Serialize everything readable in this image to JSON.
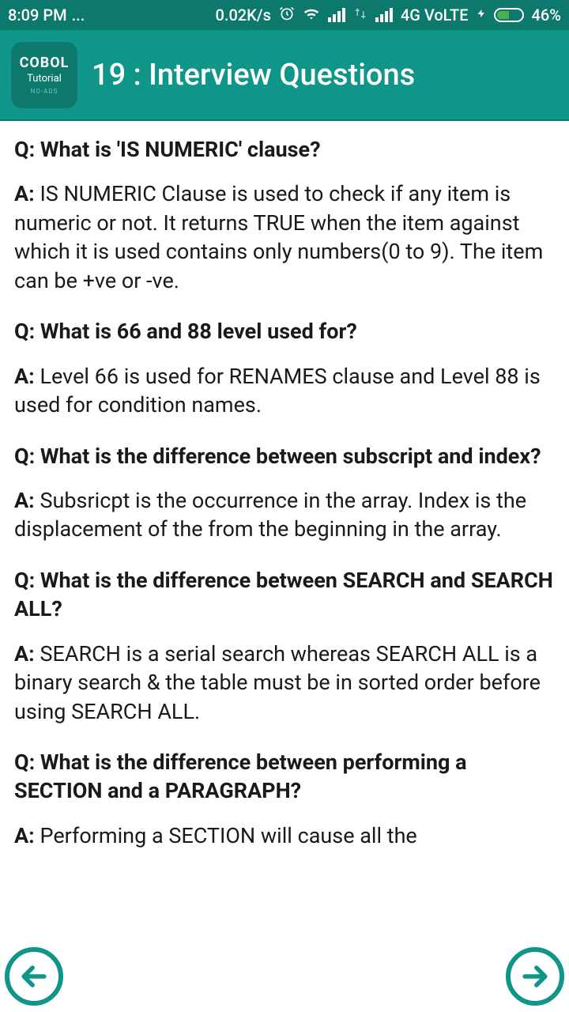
{
  "status": {
    "time": "8:09 PM",
    "dots": "...",
    "speed": "0.02K/s",
    "network": "4G VoLTE",
    "battery": "46%"
  },
  "app": {
    "icon_line1": "COBOL",
    "icon_line2": "Tutorial",
    "icon_line3": "NO-ADS",
    "title": "19 : Interview Questions"
  },
  "qa": [
    {
      "q": "Q: What is 'IS NUMERIC' clause?",
      "a": "IS NUMERIC Clause is used to check if any item is numeric or not. It returns TRUE when the item against which it is used contains only numbers(0 to 9). The item can be +ve or -ve."
    },
    {
      "q": "Q: What is 66 and 88 level used for?",
      "a": "Level 66 is used for RENAMES clause and Level 88 is used for condition names."
    },
    {
      "q": "Q: What is the difference between subscript and index?",
      "a": "Subsricpt is the occurrence in the array. Index is the displacement of the from the beginning in the array."
    },
    {
      "q": "Q: What is the difference between SEARCH and SEARCH ALL?",
      "a": "SEARCH is a serial search whereas SEARCH ALL is a binary search & the table must be in sorted order before using SEARCH ALL."
    },
    {
      "q": "Q: What is the difference between performing a SECTION and a PARAGRAPH?",
      "a": "Performing a SECTION will cause all the"
    }
  ],
  "labels": {
    "answer_prefix": "A: "
  }
}
